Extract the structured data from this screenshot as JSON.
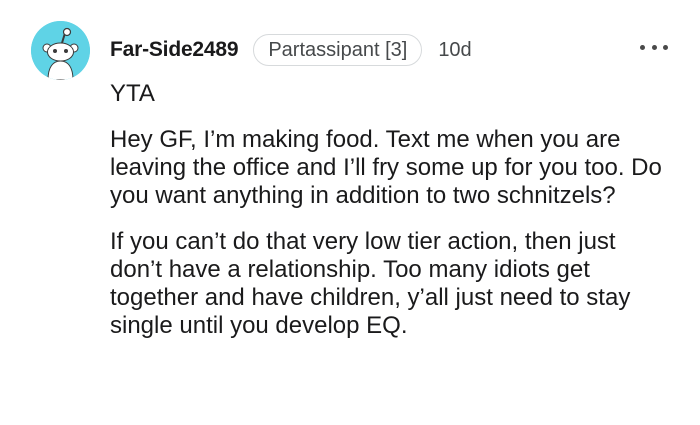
{
  "comment": {
    "avatar_icon": "reddit-snoo-avatar-icon",
    "avatar_color": "#5fd3e6",
    "username": "Far-Side2489",
    "flair": "Partassipant [3]",
    "time": "10d",
    "more_icon": "more-options-icon",
    "paragraphs": [
      "YTA",
      "Hey GF, I’m making food. Text me when you are leaving the office and I’ll fry some up for you too. Do you want anything in addition to two schnitzels?",
      "If you can’t do that very low tier action, then just don’t have a relationship. Too many idiots get together and have children, y’all just need to stay single until you develop EQ."
    ]
  }
}
